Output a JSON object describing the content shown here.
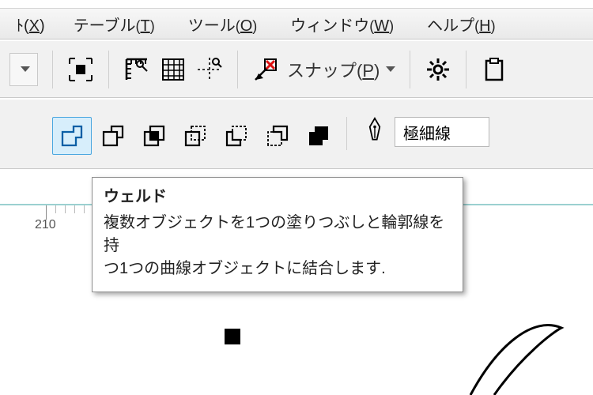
{
  "menubar": {
    "first_fragment_pre": "ﾄ(",
    "first_fragment_key": "X",
    "first_fragment_post": ")",
    "items": [
      {
        "label": "テーブル",
        "key": "T"
      },
      {
        "label": "ツール",
        "key": "O"
      },
      {
        "label": "ウィンドウ",
        "key": "W"
      },
      {
        "label": "ヘルプ",
        "key": "H"
      }
    ]
  },
  "toolbar1": {
    "snap_label": "スナップ",
    "snap_key": "P"
  },
  "toolbar2": {
    "outline_value": "極細線"
  },
  "ruler": {
    "tick_label_210": "210"
  },
  "tooltip": {
    "title": "ウェルド",
    "body_line1": "複数オブジェクトを1つの塗りつぶしと輪郭線を持",
    "body_line2": "つ1つの曲線オブジェクトに結合します."
  },
  "icons": {
    "dropdown": "chevron-down-icon",
    "full_extent": "full-extent-icon",
    "ruler_marker": "ruler-corner-icon",
    "grid": "grid-icon",
    "guides": "guide-cross-icon",
    "snap_target": "snap-target-icon",
    "gear": "gear-icon",
    "clipboard": "clipboard-icon",
    "pen_nib": "pen-nib-icon",
    "weld": "weld-icon",
    "trim": "trim-icon",
    "intersect": "intersect-icon",
    "simplify": "simplify-icon",
    "front_minus_back": "front-minus-back-icon",
    "back_minus_front": "back-minus-front-icon",
    "boundary": "boundary-icon"
  }
}
